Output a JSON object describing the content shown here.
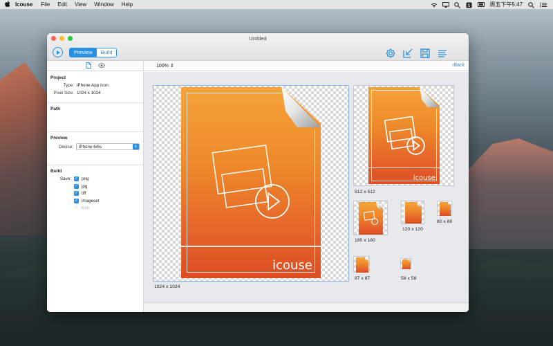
{
  "menubar": {
    "app_name": "Icouse",
    "items": [
      "File",
      "Edit",
      "View",
      "Window",
      "Help"
    ],
    "clock": "周五下午5:47"
  },
  "window": {
    "title": "Untitled",
    "tabs": {
      "preview": "Preview",
      "build": "Build"
    },
    "zoom": "100%",
    "back": "Back"
  },
  "sidebar": {
    "project": {
      "title": "Project",
      "type_label": "Type:",
      "type_value": "iPhone App Icon",
      "size_label": "Pixel Size:",
      "size_value": "1024 x 1024"
    },
    "path": {
      "title": "Path"
    },
    "preview": {
      "title": "Preview",
      "device_label": "Device:",
      "device_value": "iPhone 6/6s"
    },
    "build": {
      "title": "Build",
      "save_label": "Save:",
      "formats": [
        {
          "label": "png",
          "checked": true,
          "enabled": true
        },
        {
          "label": "jpg",
          "checked": true,
          "enabled": true
        },
        {
          "label": "tiff",
          "checked": true,
          "enabled": true
        },
        {
          "label": "imageset",
          "checked": true,
          "enabled": true
        },
        {
          "label": "icns",
          "checked": true,
          "enabled": false
        }
      ]
    }
  },
  "canvas": {
    "icon_text": "icouse",
    "previews": [
      {
        "label": "1024 x 1024"
      },
      {
        "label": "512 x 512"
      },
      {
        "label": "180 x 180"
      },
      {
        "label": "120 x 120"
      },
      {
        "label": "80 x 80"
      },
      {
        "label": "87 x 87"
      },
      {
        "label": "58 x 58"
      }
    ]
  },
  "colors": {
    "accent": "#2a90e0",
    "icon_top": "#f5a23a",
    "icon_bottom": "#dd4e23"
  }
}
